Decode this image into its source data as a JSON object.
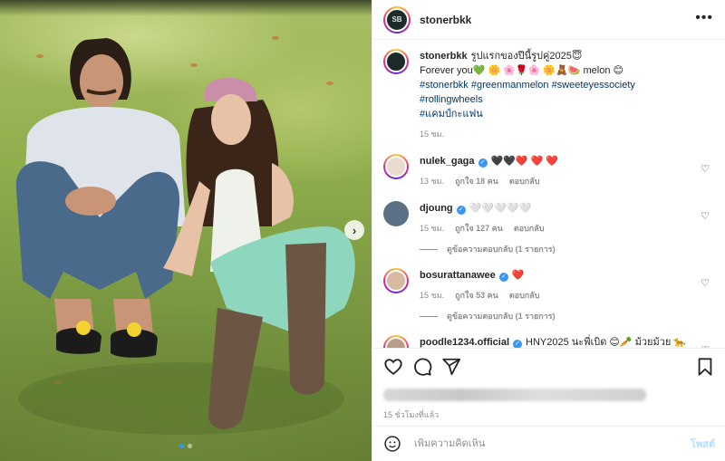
{
  "post": {
    "username": "stonerbkk",
    "avatar_initials": "SB",
    "more_label": "•••",
    "next_label": "›"
  },
  "caption": {
    "username": "stonerbkk",
    "text_line1": "รูปแรกของปีนี้รูปคู่2025😇",
    "text_line2": "Forever you💚 🌼 🌸🌹🌸 🌼🧸🍉 melon 😊",
    "hashtags": [
      "#stonerbkk",
      "#greenmanmelon",
      "#sweeteyessociety",
      "#rollingwheels",
      "#แคมป์กะแฟน"
    ],
    "time": "15 ชม."
  },
  "comments": [
    {
      "username": "nulek_gaga",
      "verified": true,
      "text": "🖤🖤❤️ ❤️ ❤️",
      "time": "13 ชม.",
      "likes": "ถูกใจ 18 คน",
      "reply": "ตอบกลับ",
      "view_replies": ""
    },
    {
      "username": "djoung",
      "verified": true,
      "text": "🤍🤍🤍🤍🤍",
      "time": "15 ชม.",
      "likes": "ถูกใจ 127 คน",
      "reply": "ตอบกลับ",
      "view_replies": "ดูข้อความตอบกลับ (1 รายการ)"
    },
    {
      "username": "bosurattanawee",
      "verified": true,
      "text": "❤️",
      "time": "15 ชม.",
      "likes": "ถูกใจ 53 คน",
      "reply": "ตอบกลับ",
      "view_replies": "ดูข้อความตอบกลับ (1 รายการ)"
    },
    {
      "username": "poodle1234.official",
      "verified": true,
      "text": "HNY2025 นะพี่เบิด 😊🥕 ม้วยม้วย 🐆 ",
      "time": "",
      "likes": "",
      "reply": "",
      "view_replies": ""
    }
  ],
  "footer": {
    "time": "15 ชั่วโมงที่แล้ว",
    "comment_placeholder": "เพิ่มความคิดเห็น",
    "post_label": "โพสต์"
  },
  "colors": {
    "verified": "#3897f0",
    "link": "#00376b",
    "muted": "#8e8e8e",
    "post_disabled": "#b2dffc"
  }
}
